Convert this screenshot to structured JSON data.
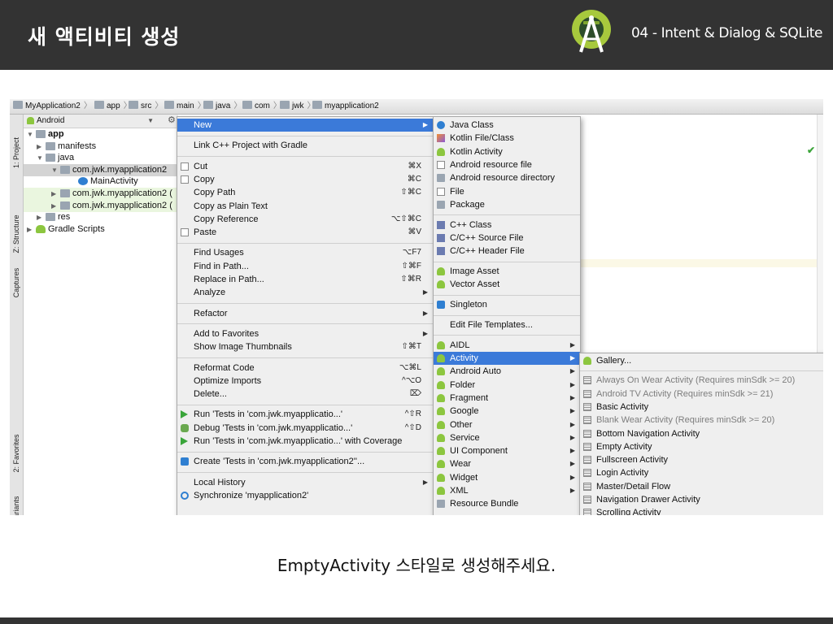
{
  "slide": {
    "title": "새 액티비티 생성",
    "subtitle": "04 - Intent & Dialog & SQLite",
    "caption": "EmptyActivity 스타일로 생성해주세요."
  },
  "breadcrumb": [
    {
      "label": "MyApplication2",
      "icon": "project-icon"
    },
    {
      "label": "app",
      "icon": "module-icon"
    },
    {
      "label": "src",
      "icon": "folder-icon"
    },
    {
      "label": "main",
      "icon": "folder-icon"
    },
    {
      "label": "java",
      "icon": "folder-icon"
    },
    {
      "label": "com",
      "icon": "folder-icon"
    },
    {
      "label": "jwk",
      "icon": "folder-icon"
    },
    {
      "label": "myapplication2",
      "icon": "folder-icon"
    }
  ],
  "tool_windows": {
    "project": "1: Project",
    "structure": "Z: Structure",
    "captures": "Captures",
    "favorites": "2: Favorites",
    "build_variants": "Build Variants"
  },
  "project_view": {
    "selector": "Android",
    "tree": [
      {
        "label": "app",
        "arrow": "▼",
        "bold": true
      },
      {
        "label": "manifests",
        "arrow": "▶"
      },
      {
        "label": "java",
        "arrow": "▼"
      },
      {
        "label": "com.jwk.myapplication2",
        "arrow": "▼",
        "selected": true
      },
      {
        "label": "MainActivity",
        "arrow": ""
      },
      {
        "label": "com.jwk.myapplication2 (",
        "arrow": "▶",
        "highlight": true
      },
      {
        "label": "com.jwk.myapplication2 (",
        "arrow": "▶",
        "highlight": true
      },
      {
        "label": "res",
        "arrow": "▶"
      },
      {
        "label": "Gradle Scripts",
        "arrow": "▶"
      }
    ]
  },
  "context_menu": [
    {
      "label": "New",
      "shortcut": "",
      "submenu": true,
      "active": true
    },
    {
      "sep": true
    },
    {
      "label": "Link C++ Project with Gradle",
      "shortcut": ""
    },
    {
      "sep": true
    },
    {
      "label": "Cut",
      "shortcut": "⌘X",
      "icon": "cut-icon"
    },
    {
      "label": "Copy",
      "shortcut": "⌘C",
      "icon": "copy-icon"
    },
    {
      "label": "Copy Path",
      "shortcut": "⇧⌘C"
    },
    {
      "label": "Copy as Plain Text",
      "shortcut": ""
    },
    {
      "label": "Copy Reference",
      "shortcut": "⌥⇧⌘C"
    },
    {
      "label": "Paste",
      "shortcut": "⌘V",
      "icon": "paste-icon"
    },
    {
      "sep": true
    },
    {
      "label": "Find Usages",
      "shortcut": "⌥F7"
    },
    {
      "label": "Find in Path...",
      "shortcut": "⇧⌘F"
    },
    {
      "label": "Replace in Path...",
      "shortcut": "⇧⌘R"
    },
    {
      "label": "Analyze",
      "shortcut": "",
      "submenu": true
    },
    {
      "sep": true
    },
    {
      "label": "Refactor",
      "shortcut": "",
      "submenu": true
    },
    {
      "sep": true
    },
    {
      "label": "Add to Favorites",
      "shortcut": "",
      "submenu": true
    },
    {
      "label": "Show Image Thumbnails",
      "shortcut": "⇧⌘T"
    },
    {
      "sep": true
    },
    {
      "label": "Reformat Code",
      "shortcut": "⌥⌘L"
    },
    {
      "label": "Optimize Imports",
      "shortcut": "^⌥O"
    },
    {
      "label": "Delete...",
      "shortcut": "⌦"
    },
    {
      "sep": true
    },
    {
      "label": "Run 'Tests in 'com.jwk.myapplicatio...'",
      "shortcut": "^⇧R",
      "icon": "run-icon"
    },
    {
      "label": "Debug 'Tests in 'com.jwk.myapplicatio...'",
      "shortcut": "^⇧D",
      "icon": "debug-icon"
    },
    {
      "label": "Run 'Tests in 'com.jwk.myapplicatio...' with Coverage",
      "shortcut": "",
      "icon": "coverage-icon"
    },
    {
      "sep": true
    },
    {
      "label": "Create 'Tests in 'com.jwk.myapplication2''...",
      "shortcut": "",
      "icon": "create-icon"
    },
    {
      "sep": true
    },
    {
      "label": "Local History",
      "shortcut": "",
      "submenu": true
    },
    {
      "label": "Synchronize 'myapplication2'",
      "shortcut": "",
      "icon": "sync-icon"
    }
  ],
  "new_menu": [
    {
      "label": "Java Class",
      "icon": "class-icon"
    },
    {
      "label": "Kotlin File/Class",
      "icon": "kotlin-icon"
    },
    {
      "label": "Kotlin Activity",
      "icon": "android-icon"
    },
    {
      "label": "Android resource file",
      "icon": "file-icon"
    },
    {
      "label": "Android resource directory",
      "icon": "folder-icon"
    },
    {
      "label": "File",
      "icon": "file-icon"
    },
    {
      "label": "Package",
      "icon": "folder-icon"
    },
    {
      "sep": true
    },
    {
      "label": "C++ Class",
      "icon": "cpp-icon"
    },
    {
      "label": "C/C++ Source File",
      "icon": "cpp-icon"
    },
    {
      "label": "C/C++ Header File",
      "icon": "cpp-icon"
    },
    {
      "sep": true
    },
    {
      "label": "Image Asset",
      "icon": "android-icon"
    },
    {
      "label": "Vector Asset",
      "icon": "android-icon"
    },
    {
      "sep": true
    },
    {
      "label": "Singleton",
      "icon": "singleton-icon"
    },
    {
      "sep": true
    },
    {
      "label": "Edit File Templates...",
      "icon": ""
    },
    {
      "sep": true
    },
    {
      "label": "AIDL",
      "icon": "android-icon",
      "submenu": true
    },
    {
      "label": "Activity",
      "icon": "android-icon",
      "submenu": true,
      "active": true
    },
    {
      "label": "Android Auto",
      "icon": "android-icon",
      "submenu": true
    },
    {
      "label": "Folder",
      "icon": "android-icon",
      "submenu": true
    },
    {
      "label": "Fragment",
      "icon": "android-icon",
      "submenu": true
    },
    {
      "label": "Google",
      "icon": "android-icon",
      "submenu": true
    },
    {
      "label": "Other",
      "icon": "android-icon",
      "submenu": true
    },
    {
      "label": "Service",
      "icon": "android-icon",
      "submenu": true
    },
    {
      "label": "UI Component",
      "icon": "android-icon",
      "submenu": true
    },
    {
      "label": "Wear",
      "icon": "android-icon",
      "submenu": true
    },
    {
      "label": "Widget",
      "icon": "android-icon",
      "submenu": true
    },
    {
      "label": "XML",
      "icon": "android-icon",
      "submenu": true
    },
    {
      "label": "Resource Bundle",
      "icon": "bundle-icon"
    }
  ],
  "activity_menu": [
    {
      "label": "Gallery...",
      "icon": "android-icon"
    },
    {
      "sep": true
    },
    {
      "label": "Always On Wear Activity (Requires minSdk >= 20)",
      "icon": "template-icon",
      "disabled": true
    },
    {
      "label": "Android TV Activity (Requires minSdk >= 21)",
      "icon": "template-icon",
      "disabled": true
    },
    {
      "label": "Basic Activity",
      "icon": "template-icon"
    },
    {
      "label": "Blank Wear Activity (Requires minSdk >= 20)",
      "icon": "template-icon",
      "disabled": true
    },
    {
      "label": "Bottom Navigation Activity",
      "icon": "template-icon"
    },
    {
      "label": "Empty Activity",
      "icon": "template-icon"
    },
    {
      "label": "Fullscreen Activity",
      "icon": "template-icon"
    },
    {
      "label": "Login Activity",
      "icon": "template-icon"
    },
    {
      "label": "Master/Detail Flow",
      "icon": "template-icon"
    },
    {
      "label": "Navigation Drawer Activity",
      "icon": "template-icon"
    },
    {
      "label": "Scrolling Activity",
      "icon": "template-icon"
    }
  ]
}
